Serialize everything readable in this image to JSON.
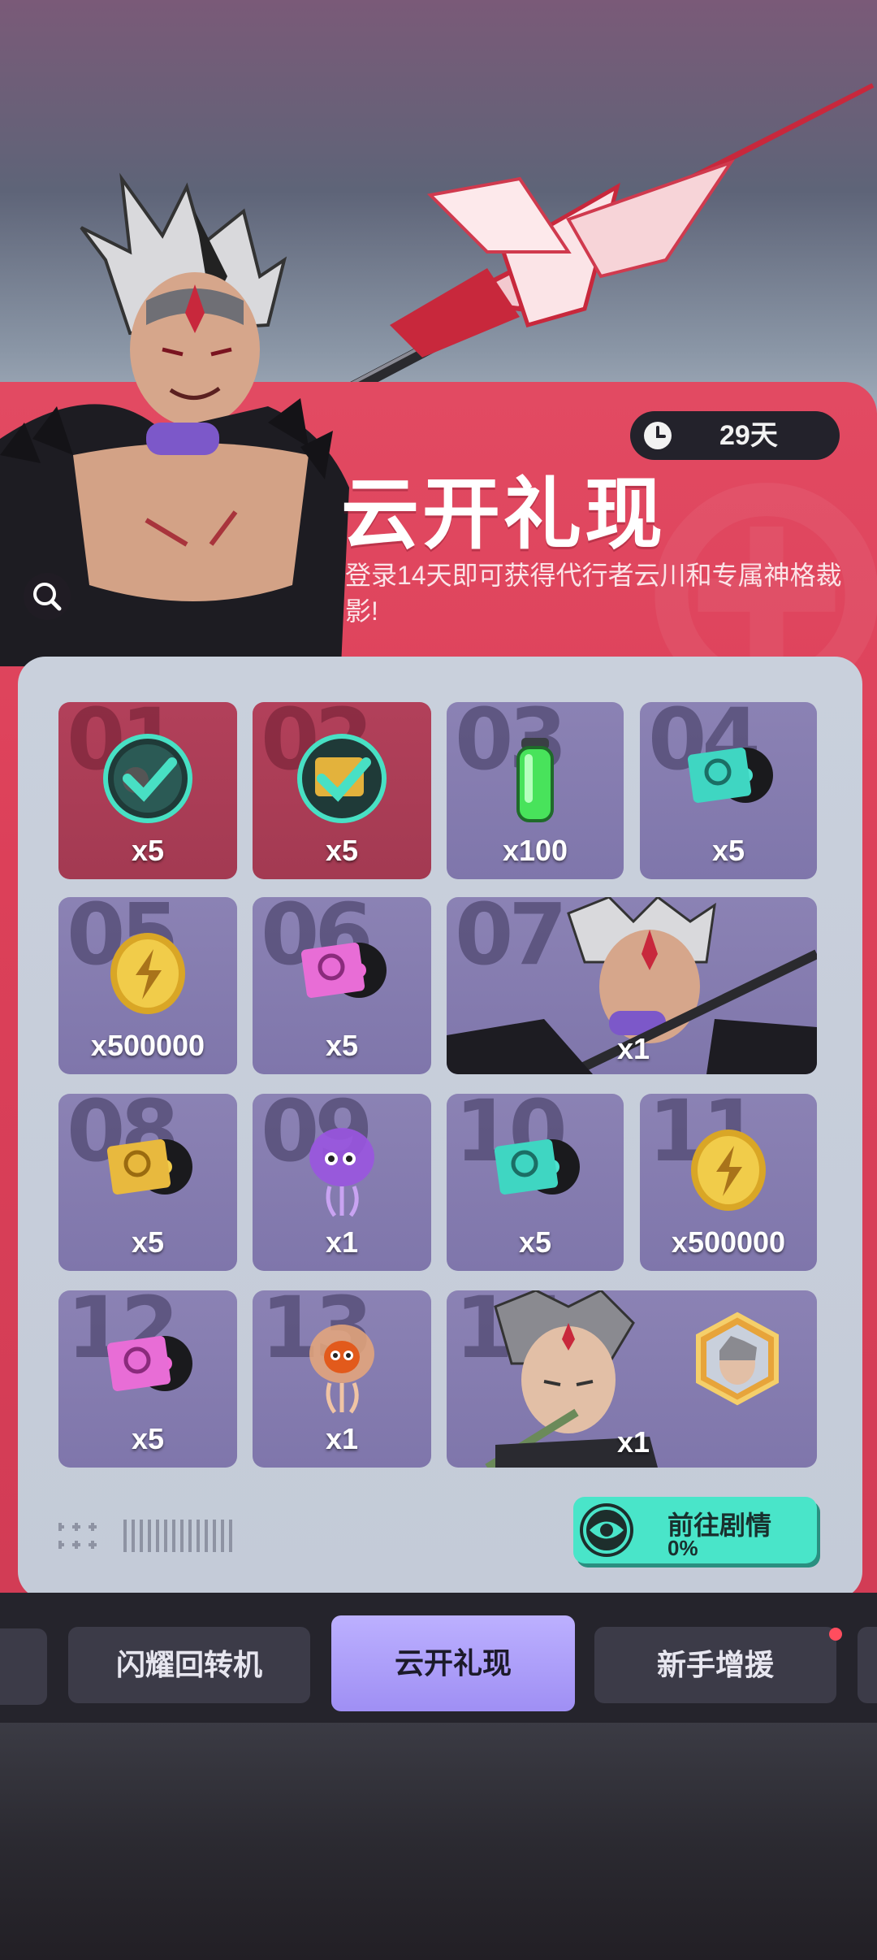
{
  "event": {
    "timer_text": "29天",
    "title": "云开礼现",
    "subtitle": "登录14天即可获得代行者云川和专属神格裁影!"
  },
  "rewards": [
    {
      "day": "01",
      "qty": "x5",
      "icon": "gear-disc-icon",
      "claimed": true
    },
    {
      "day": "02",
      "qty": "x5",
      "icon": "gold-vinyl-record-icon",
      "claimed": true
    },
    {
      "day": "03",
      "qty": "x100",
      "icon": "green-potion-icon",
      "claimed": false
    },
    {
      "day": "04",
      "qty": "x5",
      "icon": "teal-vinyl-record-icon",
      "claimed": false
    },
    {
      "day": "05",
      "qty": "x500000",
      "icon": "gold-coin-icon",
      "claimed": false
    },
    {
      "day": "06",
      "qty": "x5",
      "icon": "pink-vinyl-record-icon",
      "claimed": false
    },
    {
      "day": "07",
      "qty": "x1",
      "icon": "character-portrait-icon",
      "claimed": false
    },
    {
      "day": "08",
      "qty": "x5",
      "icon": "gold-vinyl-record-icon",
      "claimed": false
    },
    {
      "day": "09",
      "qty": "x1",
      "icon": "purple-jellyfish-icon",
      "claimed": false
    },
    {
      "day": "10",
      "qty": "x5",
      "icon": "teal-vinyl-record-icon",
      "claimed": false
    },
    {
      "day": "11",
      "qty": "x500000",
      "icon": "gold-coin-icon",
      "claimed": false
    },
    {
      "day": "12",
      "qty": "x5",
      "icon": "pink-vinyl-record-icon",
      "claimed": false
    },
    {
      "day": "13",
      "qty": "x1",
      "icon": "orange-jellyfish-icon",
      "claimed": false
    },
    {
      "day": "14",
      "qty": "x1",
      "icon": "character-avatar-icon",
      "claimed": false
    }
  ],
  "story_button": {
    "label": "前往剧情",
    "progress": "0%"
  },
  "tabs": [
    {
      "label": "闪耀回转机",
      "active": false
    },
    {
      "label": "云开礼现",
      "active": true
    },
    {
      "label": "新手增援",
      "active": false,
      "badge": true
    }
  ],
  "colors": {
    "panel_red": "#dc4059",
    "card_purple": "#857cb0",
    "claimed_red": "#a83c55",
    "accent_teal": "#49e5c9",
    "active_tab": "#ab9dfa"
  }
}
